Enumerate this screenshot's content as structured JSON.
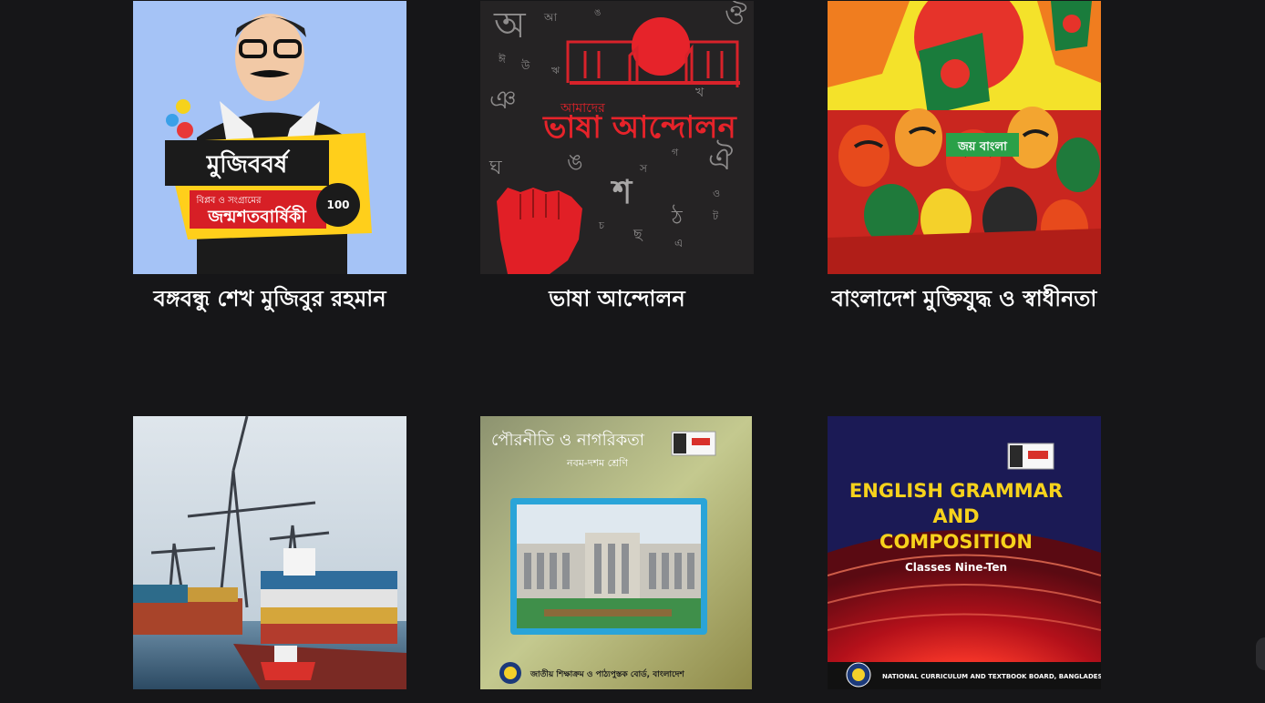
{
  "cards": [
    {
      "title": "বঙ্গবন্ধু শেখ মুজিবুর রহমান",
      "art": {
        "badge": "মুজিববর্ষ",
        "sub": "বিপ্লব ও সংগ্রামের",
        "banner": "জন্মশতবার্ষিকী",
        "years": "100"
      }
    },
    {
      "title": "ভাষা আন্দোলন",
      "art": {
        "small": "আমাদের",
        "big": "ভাষা আন্দোলন"
      }
    },
    {
      "title": "বাংলাদেশ মুক্তিযুদ্ধ ও স্বাধীনতা",
      "art": {
        "sign": "জয় বাংলা"
      }
    },
    {
      "title": "",
      "art": {}
    },
    {
      "title": "",
      "art": {
        "heading": "পৌরনীতি ও নাগরিকতা",
        "class": "নবম-দশম শ্রেণি",
        "board": "জাতীয় শিক্ষাক্রম ও পাঠ্যপুস্তক বোর্ড, বাংলাদেশ"
      }
    },
    {
      "title": "",
      "art": {
        "l1": "ENGLISH GRAMMAR",
        "l2": "AND",
        "l3": "COMPOSITION",
        "cls": "Classes Nine-Ten",
        "board": "NATIONAL CURRICULUM AND TEXTBOOK BOARD, BANGLADESH"
      }
    }
  ]
}
